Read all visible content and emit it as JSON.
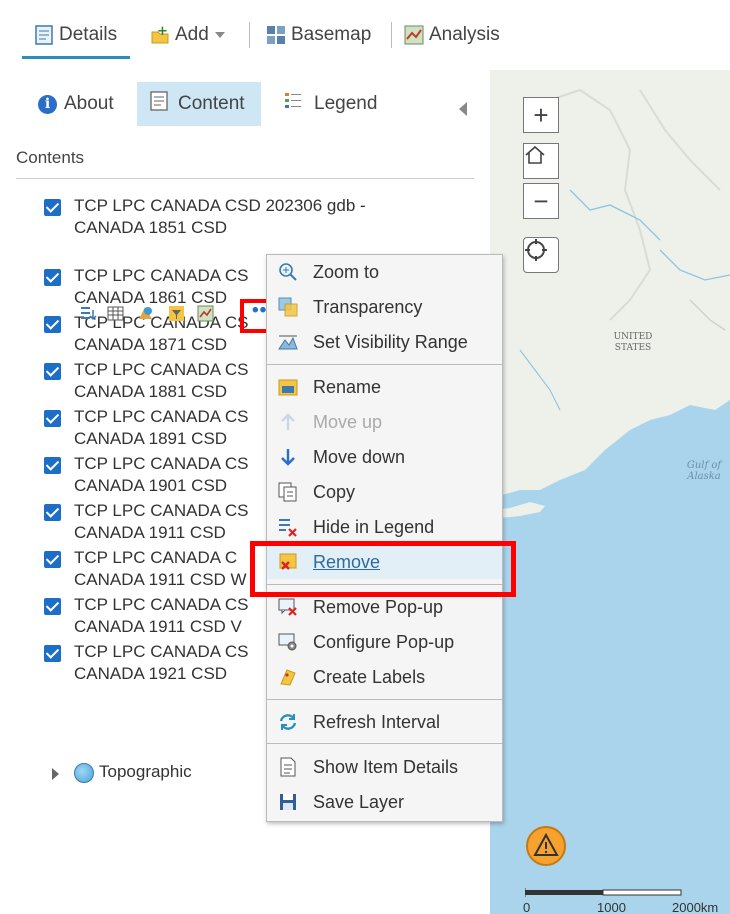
{
  "toolbar": {
    "details_label": "Details",
    "add_label": "Add",
    "basemap_label": "Basemap",
    "analysis_label": "Analysis",
    "accent_color": "#2a8fbd"
  },
  "panel": {
    "tabs": [
      {
        "label": "About",
        "icon": "info-icon"
      },
      {
        "label": "Content",
        "icon": "content-icon"
      },
      {
        "label": "Legend",
        "icon": "legend-icon"
      }
    ],
    "contents_title": "Contents",
    "layers": [
      {
        "line1": "TCP LPC CANADA CSD 202306 gdb -",
        "line2": "CANADA 1851 CSD",
        "checked": true
      },
      {
        "line1": "TCP LPC CANADA CS",
        "line2": "CANADA 1861 CSD",
        "checked": true
      },
      {
        "line1": "TCP LPC CANADA CS",
        "line2": "CANADA 1871 CSD",
        "checked": true
      },
      {
        "line1": "TCP LPC CANADA CS",
        "line2": "CANADA 1881 CSD",
        "checked": true
      },
      {
        "line1": "TCP LPC CANADA CS",
        "line2": "CANADA 1891 CSD",
        "checked": true
      },
      {
        "line1": "TCP LPC CANADA CS",
        "line2": "CANADA 1901 CSD",
        "checked": true
      },
      {
        "line1": "TCP LPC CANADA CS",
        "line2": "CANADA 1911 CSD",
        "checked": true
      },
      {
        "line1": "TCP LPC CANADA C",
        "line2": "CANADA 1911 CSD W",
        "checked": true
      },
      {
        "line1": "TCP LPC CANADA CS",
        "line2": "CANADA 1911 CSD V",
        "checked": true
      },
      {
        "line1": "TCP LPC CANADA CS",
        "line2": "CANADA 1921 CSD",
        "checked": true
      }
    ],
    "basemap_item": "Topographic",
    "more_label": "•••"
  },
  "map": {
    "zoom_in": "+",
    "zoom_out": "−",
    "label_us": "UNITED\nSTATES",
    "label_gulf": "Gulf of\nAlaska",
    "scale": [
      "0",
      "1000",
      "2000km"
    ]
  },
  "menu": {
    "items": [
      {
        "label": "Zoom to",
        "icon": "zoom-to-icon",
        "disabled": false
      },
      {
        "label": "Transparency",
        "icon": "transparency-icon",
        "disabled": false
      },
      {
        "label": "Set Visibility Range",
        "icon": "visibility-range-icon",
        "disabled": false
      },
      {
        "label": "Rename",
        "icon": "rename-icon",
        "disabled": false
      },
      {
        "label": "Move up",
        "icon": "arrow-up-icon",
        "disabled": true
      },
      {
        "label": "Move down",
        "icon": "arrow-down-icon",
        "disabled": false
      },
      {
        "label": "Copy",
        "icon": "copy-icon",
        "disabled": false
      },
      {
        "label": "Hide in Legend",
        "icon": "hide-legend-icon",
        "disabled": false
      },
      {
        "label": "Remove",
        "icon": "remove-icon",
        "disabled": false,
        "highlighted": true
      },
      {
        "label": "Remove Pop-up",
        "icon": "remove-popup-icon",
        "disabled": false
      },
      {
        "label": "Configure Pop-up",
        "icon": "configure-popup-icon",
        "disabled": false
      },
      {
        "label": "Create Labels",
        "icon": "create-labels-icon",
        "disabled": false
      },
      {
        "label": "Refresh Interval",
        "icon": "refresh-icon",
        "disabled": false
      },
      {
        "label": "Show Item Details",
        "icon": "item-details-icon",
        "disabled": false
      },
      {
        "label": "Save Layer",
        "icon": "save-icon",
        "disabled": false
      }
    ]
  }
}
